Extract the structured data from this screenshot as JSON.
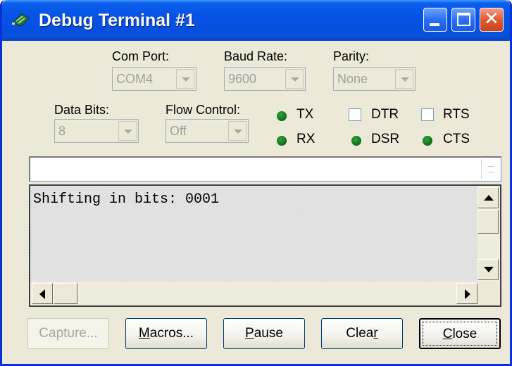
{
  "window": {
    "title": "Debug Terminal #1"
  },
  "settings": {
    "com_port": {
      "label": "Com Port:",
      "value": "COM4"
    },
    "baud_rate": {
      "label": "Baud Rate:",
      "value": "9600"
    },
    "parity": {
      "label": "Parity:",
      "value": "None"
    },
    "data_bits": {
      "label": "Data Bits:",
      "value": "8"
    },
    "flow_control": {
      "label": "Flow Control:",
      "value": "Off"
    }
  },
  "signals": {
    "tx": "TX",
    "rx": "RX",
    "dtr": "DTR",
    "rts": "RTS",
    "dsr": "DSR",
    "cts": "CTS",
    "led_color": "#0b6e13"
  },
  "terminal": {
    "send_value": "",
    "output": "Shifting in bits: 0001"
  },
  "buttons": {
    "capture": "Capture...",
    "macros_pre": "",
    "macros_key": "M",
    "macros_post": "acros...",
    "pause_pre": "",
    "pause_key": "P",
    "pause_post": "ause",
    "clear_pre": "Clea",
    "clear_key": "r",
    "clear_post": "",
    "close_pre": "",
    "close_key": "C",
    "close_post": "lose"
  },
  "colors": {
    "titlebar": "#0653e6",
    "window_bg": "#ece9d8",
    "close_button": "#e05b32"
  }
}
